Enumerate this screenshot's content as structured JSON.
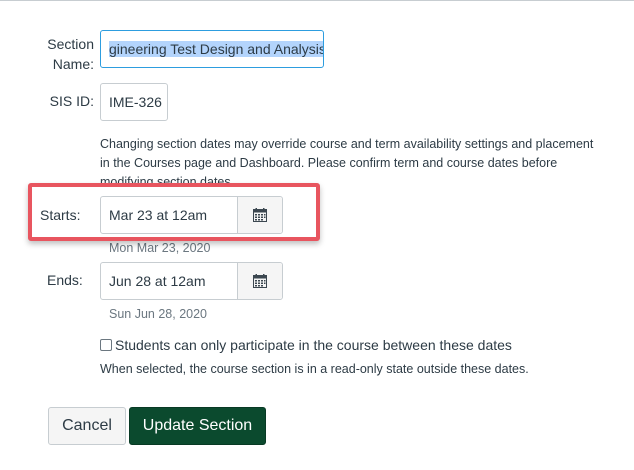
{
  "form": {
    "section_name": {
      "label_line1": "Section",
      "label_line2": "Name:",
      "value_selected": "gineering Test Design and Analysis"
    },
    "sis_id": {
      "label": "SIS ID:",
      "value": "IME-326"
    },
    "notice": {
      "line1": "Changing section dates may override course and term availability settings and placement",
      "line2": "in the Courses page and Dashboard. Please confirm term and course dates before",
      "line3": "modifying section dates."
    },
    "starts": {
      "label": "Starts:",
      "value": "Mar 23 at 12am",
      "hint": "Mon Mar 23, 2020"
    },
    "ends": {
      "label": "Ends:",
      "value": "Jun 28 at 12am",
      "hint": "Sun Jun 28, 2020"
    },
    "restrict": {
      "label": "Students can only participate in the course between these dates",
      "checked": false,
      "hint": "When selected, the course section is in a read-only state outside these dates."
    }
  },
  "buttons": {
    "cancel": "Cancel",
    "update": "Update Section"
  },
  "colors": {
    "highlight": "#e8555f",
    "primary_button": "#0b4a2e",
    "focus_border": "#2d9ddf",
    "text_selection": "#b3d4fc"
  },
  "icons": {
    "calendar": "calendar-icon"
  }
}
